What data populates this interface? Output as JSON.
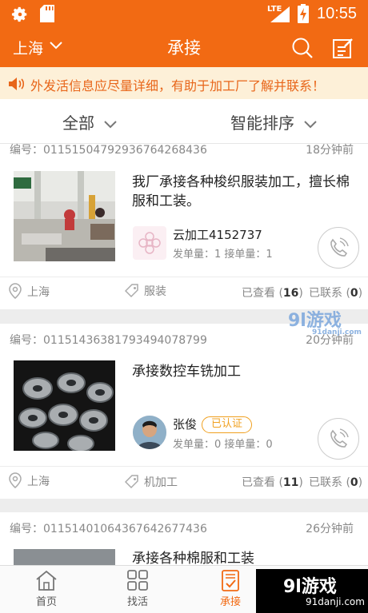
{
  "status_bar": {
    "time": "10:55",
    "network": "LTE"
  },
  "header": {
    "city": "上海",
    "title": "承接"
  },
  "notice": {
    "text": "外发活信息应尽量详细，有助于加工厂了解并联系！"
  },
  "filters": [
    {
      "label": "全部"
    },
    {
      "label": "智能排序"
    }
  ],
  "listings": [
    {
      "code": "编号：01151504792936764268436",
      "time": "18分钟前",
      "title": "我厂承接各种梭织服装加工，擅长棉服和工装。",
      "user": "云加工4152737",
      "stats": "发单量：1    接单量：1",
      "location": "上海",
      "category": "服装",
      "viewed_label": "已查看",
      "viewed": "16",
      "contacted_label": "已联系",
      "contacted": "0"
    },
    {
      "code": "编号：01151436381793494078799",
      "time": "20分钟前",
      "title": "承接数控车铣加工",
      "user": "张俊",
      "badge": "已认证",
      "stats": "发单量：0    接单量：0",
      "location": "上海",
      "category": "机加工",
      "viewed_label": "已查看",
      "viewed": "11",
      "contacted_label": "已联系",
      "contacted": "0"
    },
    {
      "code": "编号：01151401064367642677436",
      "time": "26分钟前",
      "title": "承接各种棉服和工装"
    }
  ],
  "tabbar": [
    {
      "label": "首页",
      "icon": "home-icon"
    },
    {
      "label": "找活",
      "icon": "grid-icon"
    },
    {
      "label": "承接",
      "icon": "clipboard-check-icon"
    }
  ],
  "watermark": {
    "main": "9l游戏",
    "sub": "91danji.com",
    "overlay": "9l游戏",
    "overlay_sub": "91danji.com"
  },
  "colors": {
    "brand": "#f26a13",
    "notice_bg": "#fdf0d8",
    "badge": "#f0a020"
  }
}
